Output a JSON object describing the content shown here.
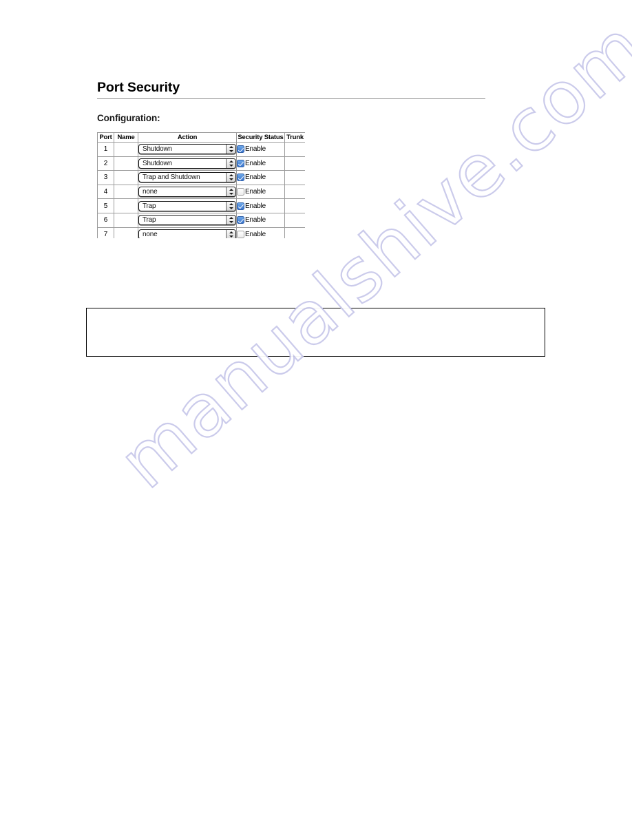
{
  "page": {
    "title": "Port Security",
    "section_label": "Configuration:",
    "watermark": "manualshive.com",
    "note_box_text": ""
  },
  "table": {
    "columns": [
      "Port",
      "Name",
      "Action",
      "Security Status",
      "Trunk"
    ],
    "rows": [
      {
        "port": "1",
        "name": "",
        "action": "Shutdown",
        "security_label": "Enable",
        "security_checked": true,
        "trunk": ""
      },
      {
        "port": "2",
        "name": "",
        "action": "Shutdown",
        "security_label": "Enable",
        "security_checked": true,
        "trunk": ""
      },
      {
        "port": "3",
        "name": "",
        "action": "Trap and Shutdown",
        "security_label": "Enable",
        "security_checked": true,
        "trunk": ""
      },
      {
        "port": "4",
        "name": "",
        "action": "none",
        "security_label": "Enable",
        "security_checked": false,
        "trunk": ""
      },
      {
        "port": "5",
        "name": "",
        "action": "Trap",
        "security_label": "Enable",
        "security_checked": true,
        "trunk": ""
      },
      {
        "port": "6",
        "name": "",
        "action": "Trap",
        "security_label": "Enable",
        "security_checked": true,
        "trunk": ""
      },
      {
        "port": "7",
        "name": "",
        "action": "none",
        "security_label": "Enable",
        "security_checked": false,
        "trunk": ""
      }
    ],
    "action_options": [
      "none",
      "Trap",
      "Shutdown",
      "Trap and Shutdown"
    ]
  },
  "colors": {
    "checkbox_on": "#3c77cf",
    "border": "#9b9b9b",
    "rule": "#8a8a8a",
    "watermark": "#c9c9ea"
  }
}
